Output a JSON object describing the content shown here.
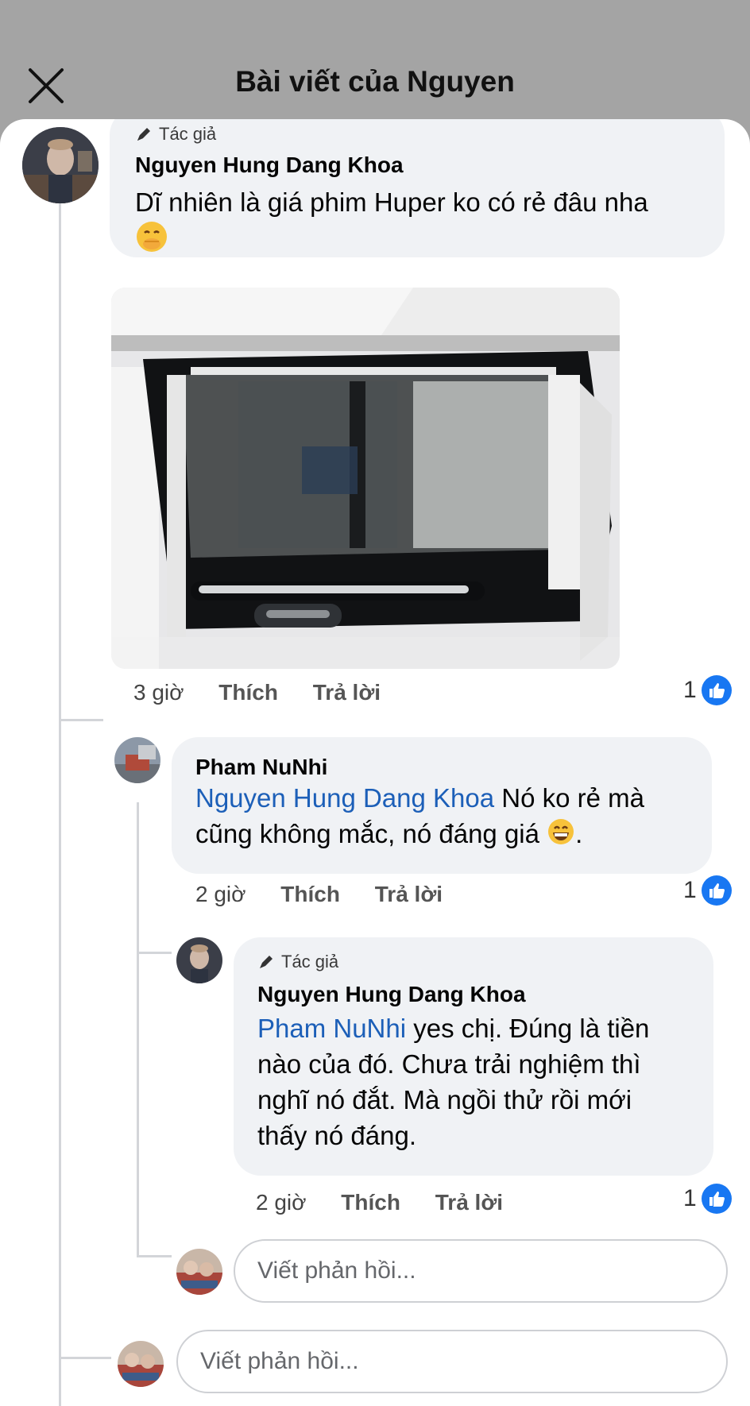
{
  "header": {
    "title": "Bài viết của Nguyen"
  },
  "comments": [
    {
      "badge": "Tác giả",
      "name": "Nguyen Hung Dang Khoa",
      "text": "Dĩ nhiên là giá phim Huper ko có rẻ đâu nha",
      "emoji_icon": "face-with-hand-over-mouth-emoji",
      "time": "3 giờ",
      "like_label": "Thích",
      "reply_label": "Trả lời",
      "likes": "1"
    },
    {
      "name": "Pham NuNhi",
      "mention": "Nguyen Hung Dang Khoa",
      "text_line1": " Nó ko rẻ mà",
      "text_line2": "cũng không mắc, nó đáng giá ",
      "text_end": ".",
      "emoji_icon": "grinning-face-emoji",
      "time": "2 giờ",
      "like_label": "Thích",
      "reply_label": "Trả lời",
      "likes": "1"
    },
    {
      "badge": "Tác giả",
      "name": "Nguyen Hung Dang Khoa",
      "mention": "Pham NuNhi",
      "text_line1": " yes chị. Đúng là tiền",
      "text_line2": "nào của đó. Chưa trải nghiệm thì",
      "text_line3": "nghĩ nó đắt. Mà ngồi thử rồi mới",
      "text_line4": "thấy nó đáng.",
      "time": "2 giờ",
      "like_label": "Thích",
      "reply_label": "Trả lời",
      "likes": "1"
    }
  ],
  "reply_inputs": [
    {
      "placeholder": "Viết phản hồi..."
    },
    {
      "placeholder": "Viết phản hồi..."
    }
  ],
  "colors": {
    "mention": "#1c5fb8",
    "like_badge": "#1877f2",
    "bubble": "#f0f2f5",
    "backdrop": "#a4a4a4"
  }
}
